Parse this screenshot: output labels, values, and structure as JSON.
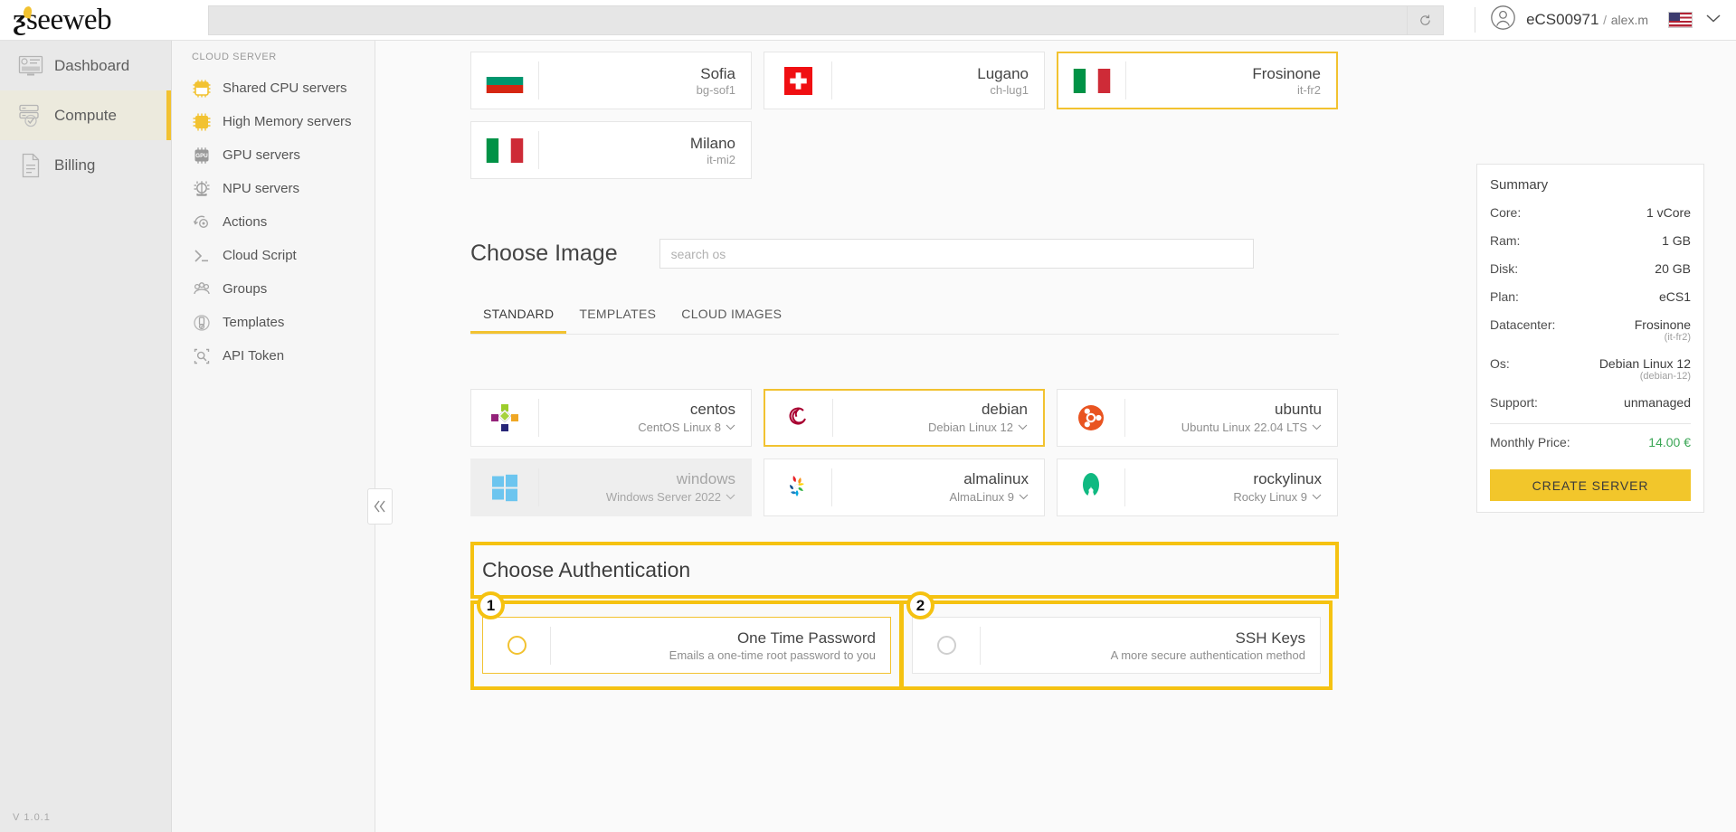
{
  "header": {
    "logo_text": "seeweb",
    "search_value": "",
    "search_placeholder": "",
    "reload_icon": "reload-icon",
    "avatar_icon": "user-avatar-icon",
    "account_id": "eCS00971",
    "separator": "/",
    "username": "alex.m",
    "flag_icon": "us-flag-icon",
    "chevron_icon": "chevron-down-icon"
  },
  "leftnav": {
    "items": [
      {
        "label": "Dashboard",
        "icon": "dashboard-icon",
        "active": false
      },
      {
        "label": "Compute",
        "icon": "server-check-icon",
        "active": true
      },
      {
        "label": "Billing",
        "icon": "document-icon",
        "active": false
      }
    ],
    "version": "V 1.0.1"
  },
  "subnav": {
    "title": "CLOUD SERVER",
    "items": [
      {
        "label": "Shared CPU servers",
        "icon": "cpu-chip-outline-icon"
      },
      {
        "label": "High Memory servers",
        "icon": "cpu-chip-filled-icon"
      },
      {
        "label": "GPU servers",
        "icon": "gpu-chip-icon"
      },
      {
        "label": "NPU servers",
        "icon": "npu-chip-icon"
      },
      {
        "label": "Actions",
        "icon": "actions-gear-icon"
      },
      {
        "label": "Cloud Script",
        "icon": "terminal-prompt-icon"
      },
      {
        "label": "Groups",
        "icon": "groups-people-icon"
      },
      {
        "label": "Templates",
        "icon": "templates-icon"
      },
      {
        "label": "API Token",
        "icon": "api-token-icon"
      }
    ]
  },
  "collapse": {
    "icon": "double-chevron-left-icon"
  },
  "datacenters": [
    {
      "city": "Sofia",
      "code": "bg-sof1",
      "flag": "bg-flag-icon",
      "selected": false
    },
    {
      "city": "Lugano",
      "code": "ch-lug1",
      "flag": "ch-flag-icon",
      "selected": false
    },
    {
      "city": "Frosinone",
      "code": "it-fr2",
      "flag": "it-flag-icon",
      "selected": true
    },
    {
      "city": "Milano",
      "code": "it-mi2",
      "flag": "it-flag-icon",
      "selected": false
    }
  ],
  "choose_image": {
    "title": "Choose Image",
    "search_value": "",
    "search_placeholder": "search os",
    "tabs": [
      {
        "label": "STANDARD",
        "active": true
      },
      {
        "label": "TEMPLATES",
        "active": false
      },
      {
        "label": "CLOUD IMAGES",
        "active": false
      }
    ],
    "images": [
      {
        "name": "centos",
        "version": "CentOS Linux 8",
        "icon": "centos-logo-icon",
        "selected": false,
        "disabled": false
      },
      {
        "name": "debian",
        "version": "Debian Linux 12",
        "icon": "debian-logo-icon",
        "selected": true,
        "disabled": false
      },
      {
        "name": "ubuntu",
        "version": "Ubuntu Linux 22.04 LTS",
        "icon": "ubuntu-logo-icon",
        "selected": false,
        "disabled": false
      },
      {
        "name": "windows",
        "version": "Windows Server 2022",
        "icon": "windows-logo-icon",
        "selected": false,
        "disabled": true
      },
      {
        "name": "almalinux",
        "version": "AlmaLinux 9",
        "icon": "almalinux-logo-icon",
        "selected": false,
        "disabled": false
      },
      {
        "name": "rockylinux",
        "version": "Rocky Linux 9",
        "icon": "rockylinux-logo-icon",
        "selected": false,
        "disabled": false
      }
    ]
  },
  "choose_auth": {
    "title": "Choose Authentication",
    "options": [
      {
        "badge": "1",
        "name": "One Time Password",
        "desc": "Emails a one-time root password to you",
        "selected": true
      },
      {
        "badge": "2",
        "name": "SSH Keys",
        "desc": "A more secure authentication method",
        "selected": false
      }
    ]
  },
  "summary": {
    "heading": "Summary",
    "rows": [
      {
        "label": "Core:",
        "value": "1 vCore",
        "sub": ""
      },
      {
        "label": "Ram:",
        "value": "1 GB",
        "sub": ""
      },
      {
        "label": "Disk:",
        "value": "20 GB",
        "sub": ""
      },
      {
        "label": "Plan:",
        "value": "eCS1",
        "sub": ""
      },
      {
        "label": "Datacenter:",
        "value": "Frosinone",
        "sub": "(it-fr2)"
      },
      {
        "label": "Os:",
        "value": "Debian Linux 12",
        "sub": "(debian-12)"
      },
      {
        "label": "Support:",
        "value": "unmanaged",
        "sub": ""
      }
    ],
    "price_label": "Monthly Price:",
    "price_value": "14.00 €",
    "create_label": "CREATE SERVER"
  },
  "colors": {
    "accent": "#f2c230",
    "annotation": "#f5c211",
    "price_green": "#3aa655",
    "active_nav_bg": "#eceadd"
  }
}
